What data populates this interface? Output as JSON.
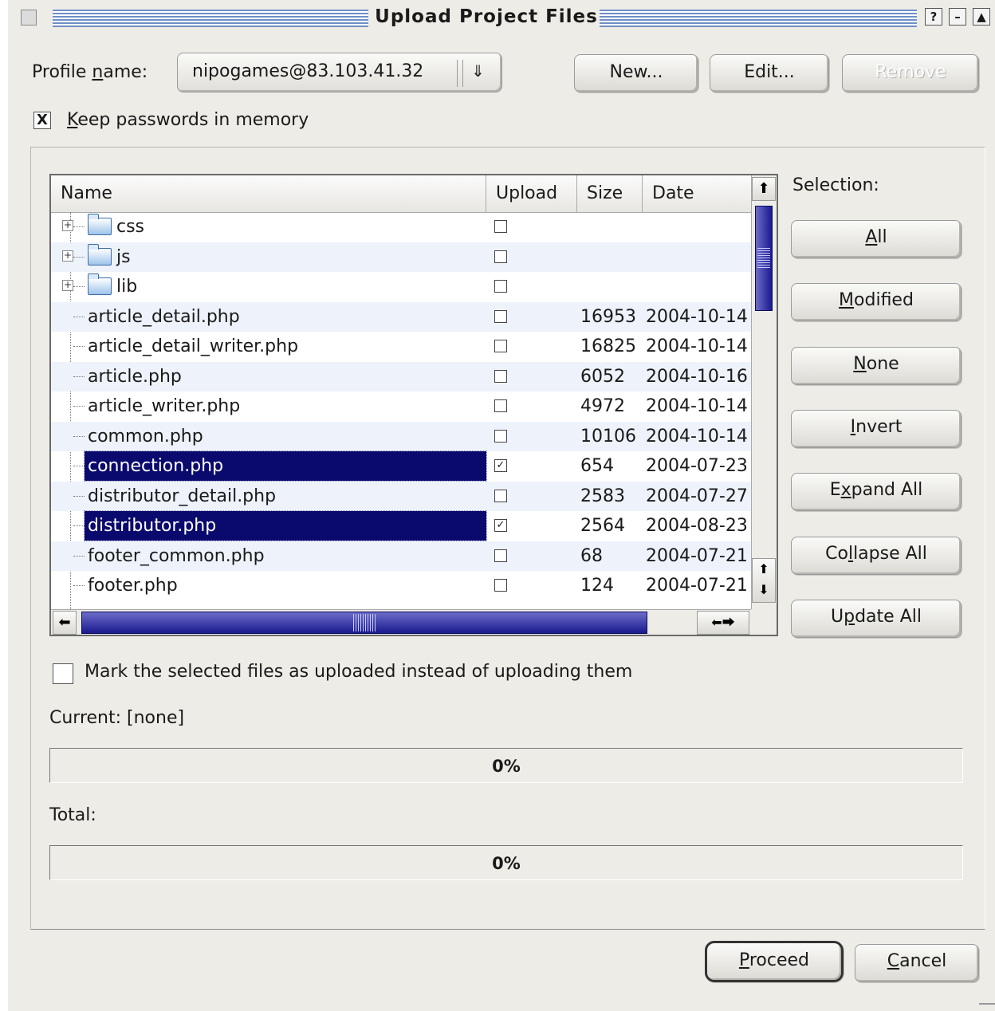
{
  "window": {
    "title": "Upload Project Files",
    "buttons": [
      "?",
      "–",
      "▲"
    ]
  },
  "profile": {
    "label_pre": "Profile ",
    "label_u": "n",
    "label_post": "ame:",
    "value": "nipogames@83.103.41.32",
    "new_label": "New...",
    "edit_label": "Edit...",
    "remove_label": "Remove"
  },
  "keep_passwords": {
    "checked_mark": "X",
    "label_u": "K",
    "label_rest": "eep passwords in memory"
  },
  "tree": {
    "columns": [
      "Name",
      "Upload",
      "Size",
      "Date"
    ],
    "rows": [
      {
        "name": "css",
        "type": "folder",
        "upload": "",
        "size": "",
        "date": ""
      },
      {
        "name": "js",
        "type": "folder",
        "upload": "",
        "size": "",
        "date": ""
      },
      {
        "name": "lib",
        "type": "folder",
        "upload": "",
        "size": "",
        "date": ""
      },
      {
        "name": "article_detail.php",
        "type": "file",
        "upload": "",
        "size": "16953",
        "date": "2004-10-14"
      },
      {
        "name": "article_detail_writer.php",
        "type": "file",
        "upload": "",
        "size": "16825",
        "date": "2004-10-14"
      },
      {
        "name": "article.php",
        "type": "file",
        "upload": "",
        "size": "6052",
        "date": "2004-10-16"
      },
      {
        "name": "article_writer.php",
        "type": "file",
        "upload": "",
        "size": "4972",
        "date": "2004-10-14"
      },
      {
        "name": "common.php",
        "type": "file",
        "upload": "",
        "size": "10106",
        "date": "2004-10-14"
      },
      {
        "name": "connection.php",
        "type": "file",
        "upload": "✓",
        "size": "654",
        "date": "2004-07-23",
        "selected": true
      },
      {
        "name": "distributor_detail.php",
        "type": "file",
        "upload": "",
        "size": "2583",
        "date": "2004-07-27"
      },
      {
        "name": "distributor.php",
        "type": "file",
        "upload": "✓",
        "size": "2564",
        "date": "2004-08-23",
        "selected": true
      },
      {
        "name": "footer_common.php",
        "type": "file",
        "upload": "",
        "size": "68",
        "date": "2004-07-21"
      },
      {
        "name": "footer.php",
        "type": "file",
        "upload": "",
        "size": "124",
        "date": "2004-07-21"
      }
    ]
  },
  "selection": {
    "label": "Selection:",
    "buttons": [
      {
        "u": "A",
        "rest": "ll",
        "pre": ""
      },
      {
        "u": "M",
        "rest": "odified",
        "pre": ""
      },
      {
        "u": "N",
        "rest": "one",
        "pre": ""
      },
      {
        "u": "I",
        "rest": "nvert",
        "pre": ""
      },
      {
        "pre": "E",
        "u": "x",
        "rest": "pand All"
      },
      {
        "pre": "Co",
        "u": "l",
        "rest": "lapse All"
      },
      {
        "pre": "U",
        "u": "p",
        "rest": "date All"
      }
    ]
  },
  "mark_uploaded": {
    "label": "Mark the selected files as uploaded instead of uploading them"
  },
  "current": {
    "label": "Current: [none]",
    "progress_text": "0%",
    "progress": 0
  },
  "total": {
    "label": "Total:",
    "progress_text": "0%",
    "progress": 0
  },
  "footer": {
    "proceed_u": "P",
    "proceed_rest": "roceed",
    "cancel_u": "C",
    "cancel_rest": "ancel"
  },
  "colors": {
    "selection": "#0a0a6e",
    "background": "#eeece7",
    "title_stripes": "#6f8fc6"
  }
}
